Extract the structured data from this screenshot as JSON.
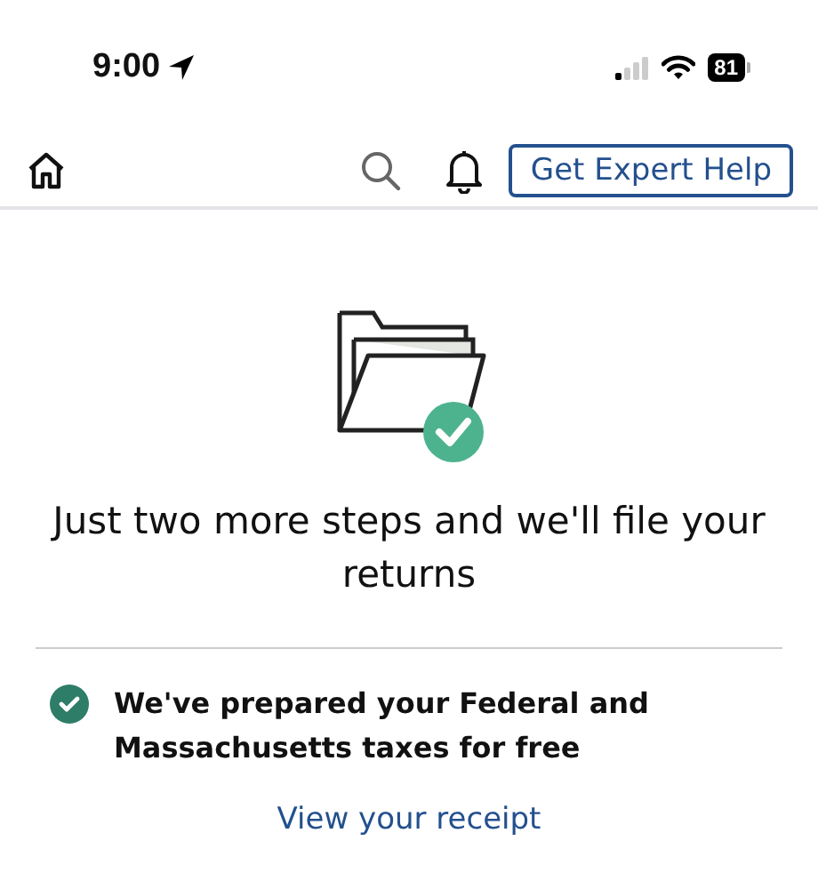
{
  "status_bar": {
    "time": "9:00",
    "battery": "81"
  },
  "header": {
    "help_button": "Get Expert Help"
  },
  "title": "Just two more steps and we'll file your returns",
  "items": [
    {
      "text": "We've prepared your Federal and Massachusetts taxes for free"
    }
  ],
  "link": "View your receipt"
}
